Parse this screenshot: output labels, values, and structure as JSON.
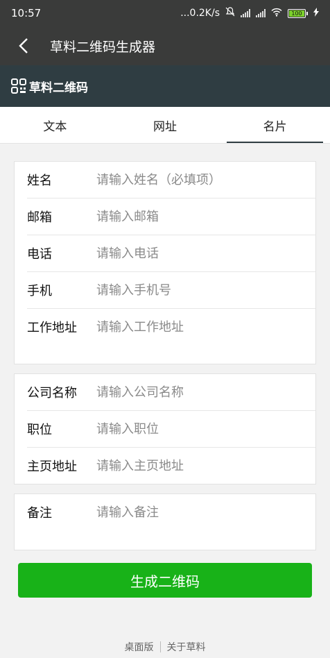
{
  "status_bar": {
    "time": "10:57",
    "net_speed": "...0.2K/s",
    "battery": "100"
  },
  "app_bar": {
    "title": "草料二维码生成器"
  },
  "brand": {
    "name": "草料二维码"
  },
  "tabs": [
    {
      "label": "文本",
      "active": false
    },
    {
      "label": "网址",
      "active": false
    },
    {
      "label": "名片",
      "active": true
    }
  ],
  "form": {
    "group1": [
      {
        "label": "姓名",
        "placeholder": "请输入姓名（必填项）"
      },
      {
        "label": "邮箱",
        "placeholder": "请输入邮箱"
      },
      {
        "label": "电话",
        "placeholder": "请输入电话"
      },
      {
        "label": "手机",
        "placeholder": "请输入手机号"
      },
      {
        "label": "工作地址",
        "placeholder": "请输入工作地址"
      }
    ],
    "group2": [
      {
        "label": "公司名称",
        "placeholder": "请输入公司名称"
      },
      {
        "label": "职位",
        "placeholder": "请输入职位"
      },
      {
        "label": "主页地址",
        "placeholder": "请输入主页地址"
      }
    ],
    "group3": [
      {
        "label": "备注",
        "placeholder": "请输入备注"
      }
    ]
  },
  "generate_button": "生成二维码",
  "footer": {
    "desktop": "桌面版",
    "about": "关于草料"
  },
  "colors": {
    "bar": "#3a3b3a",
    "brand_bar": "#2f3d42",
    "accent": "#18b218"
  }
}
